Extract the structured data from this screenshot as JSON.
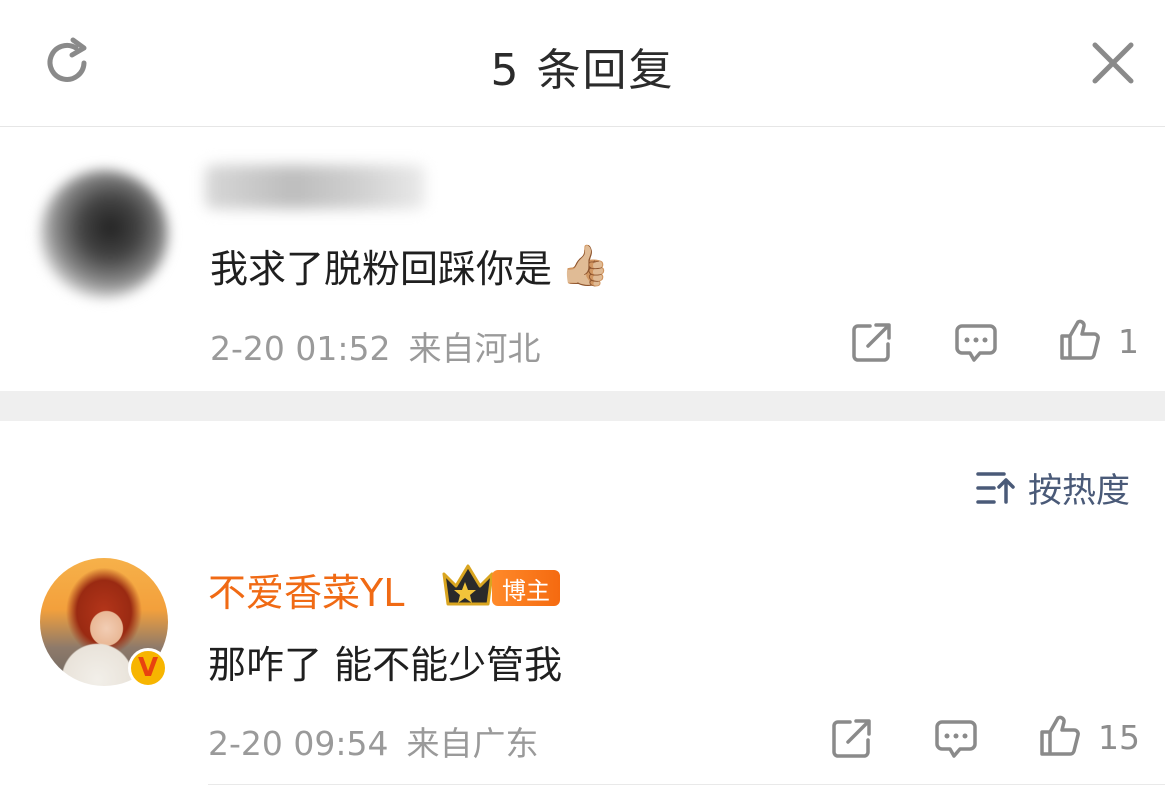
{
  "header": {
    "title": "5 条回复"
  },
  "root_comment": {
    "text": "我求了脱粉回踩你是",
    "emoji": "👍🏼",
    "date": "2-20 01:52",
    "location": "来自河北",
    "likes": "1"
  },
  "sort": {
    "label": "按热度"
  },
  "reply": {
    "username": "不爱香菜YL",
    "badge": "博主",
    "text": "那咋了 能不能少管我",
    "date": "2-20 09:54",
    "location": "来自广东",
    "likes": "15"
  },
  "colors": {
    "username": "#f06a14",
    "sort_text": "#4a5a78",
    "meta": "#9a9a9a",
    "divider": "#efefef"
  },
  "icons": [
    "refresh-icon",
    "close-icon",
    "share-icon",
    "comment-icon",
    "like-icon",
    "sort-icon",
    "crown-icon",
    "verified-icon"
  ]
}
